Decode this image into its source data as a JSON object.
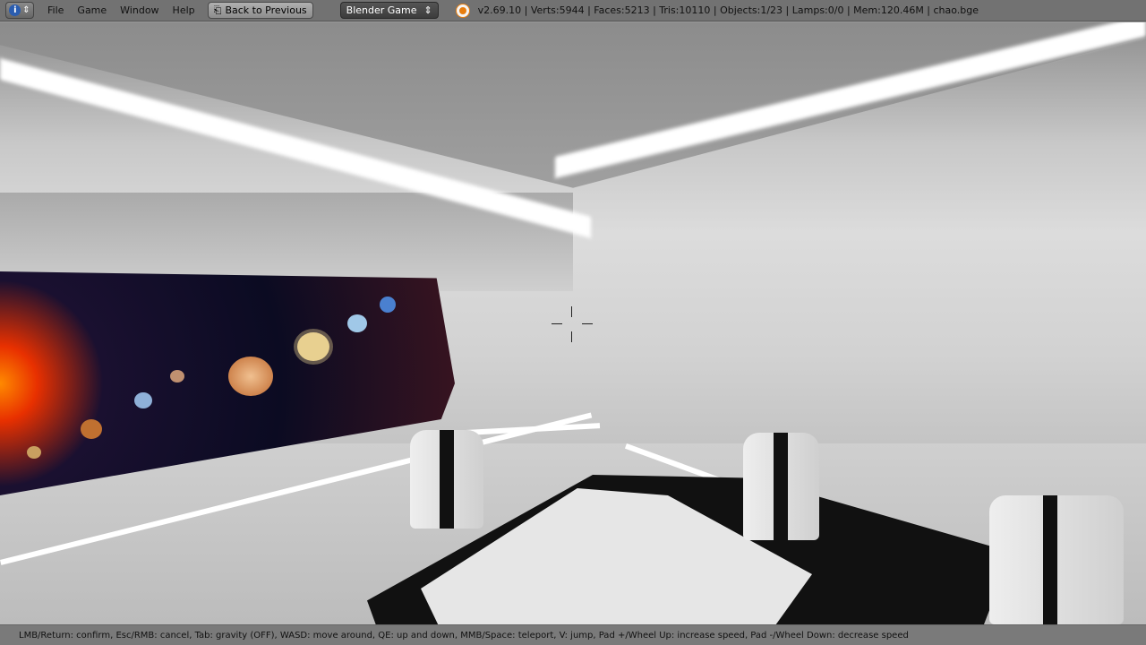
{
  "topbar": {
    "info_icon": "info-icon",
    "menus": [
      "File",
      "Game",
      "Window",
      "Help"
    ],
    "back_button": "Back to Previous",
    "engine_select": "Blender Game",
    "stats": "v2.69.10 | Verts:5944 | Faces:5213 | Tris:10110 | Objects:1/23 | Lamps:0/0 | Mem:120.46M | chao.bge"
  },
  "statusbar": {
    "text": "LMB/Return: confirm, Esc/RMB: cancel, Tab: gravity (OFF), WASD: move around, QE: up and down, MMB/Space: teleport, V: jump, Pad +/Wheel Up: increase speed, Pad -/Wheel Down: decrease speed"
  },
  "colors": {
    "accent": "#e87d0d",
    "header": "#727272"
  }
}
